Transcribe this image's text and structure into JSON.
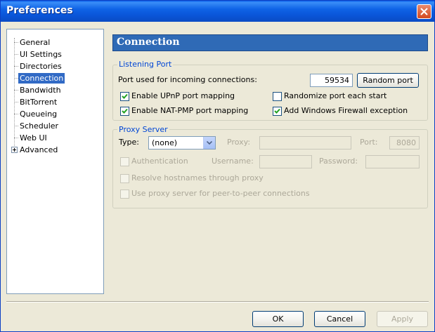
{
  "window": {
    "title": "Preferences"
  },
  "sidebar": {
    "items": [
      {
        "label": "General"
      },
      {
        "label": "UI Settings"
      },
      {
        "label": "Directories"
      },
      {
        "label": "Connection"
      },
      {
        "label": "Bandwidth"
      },
      {
        "label": "BitTorrent"
      },
      {
        "label": "Queueing"
      },
      {
        "label": "Scheduler"
      },
      {
        "label": "Web UI"
      },
      {
        "label": "Advanced"
      }
    ],
    "selected": "Connection"
  },
  "panel": {
    "title": "Connection"
  },
  "listening": {
    "legend": "Listening Port",
    "port_label": "Port used for incoming connections:",
    "port_value": "59534",
    "random_button": "Random port",
    "upnp_label": "Enable UPnP port mapping",
    "upnp_checked": true,
    "randomize_label": "Randomize port each start",
    "randomize_checked": false,
    "natpmp_label": "Enable NAT-PMP port mapping",
    "natpmp_checked": true,
    "firewall_label": "Add Windows Firewall exception",
    "firewall_checked": true
  },
  "proxy": {
    "legend": "Proxy Server",
    "type_label": "Type:",
    "type_value": "(none)",
    "proxy_label": "Proxy:",
    "proxy_value": "",
    "port_label": "Port:",
    "port_value": "8080",
    "auth_label": "Authentication",
    "auth_checked": false,
    "username_label": "Username:",
    "username_value": "",
    "password_label": "Password:",
    "password_value": "",
    "resolve_label": "Resolve hostnames through proxy",
    "resolve_checked": false,
    "p2p_label": "Use proxy server for peer-to-peer connections",
    "p2p_checked": false
  },
  "footer": {
    "ok": "OK",
    "cancel": "Cancel",
    "apply": "Apply"
  },
  "colors": {
    "titlebar": "#0a55d8",
    "selection": "#316ac5",
    "header_bar": "#2f6ab6",
    "group_legend": "#0046d5"
  }
}
